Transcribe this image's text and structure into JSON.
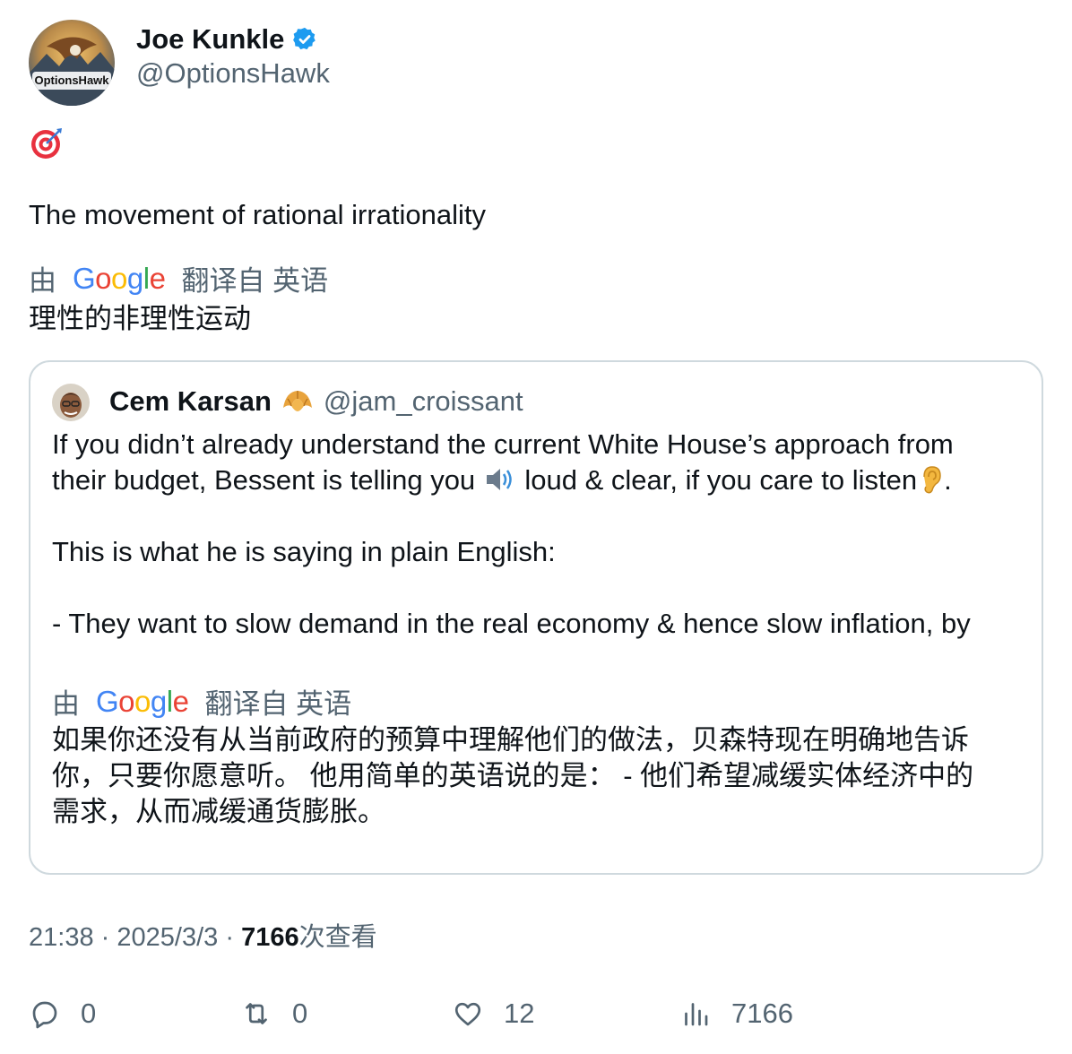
{
  "author": {
    "name": "Joe Kunkle",
    "handle": "@OptionsHawk",
    "avatar_text": "OptionsHawk"
  },
  "tweet": {
    "emoji": "target-emoji",
    "text": "The movement of rational irrationality",
    "translation": {
      "by_label": "由",
      "provider": "Google",
      "from_label": "翻译自 英语",
      "text": "理性的非理性运动"
    }
  },
  "quote": {
    "name": "Cem Karsan",
    "name_emoji": "croissant-emoji",
    "handle": "@jam_croissant",
    "line1": "If you didn’t already understand the current White House’s approach from",
    "line2_a": "their budget, Bessent is telling you ",
    "line2_b": " loud & clear, if you care to listen",
    "line2_c": ".",
    "line3": "This is what he is saying in plain English:",
    "line4": "- They want to slow demand in the real economy & hence slow inflation, by",
    "translation": {
      "by_label": "由",
      "provider": "Google",
      "from_label": "翻译自 英语",
      "line1": "如果你还没有从当前政府的预算中理解他们的做法，贝森特现在明确地告诉",
      "line2": "你，只要你愿意听。 他用简单的英语说的是： - 他们希望减缓实体经济中的",
      "line3": "需求，从而减缓通货膨胀。"
    }
  },
  "meta": {
    "time": "21:38",
    "sep": "·",
    "date": "2025/3/3",
    "views": "7166",
    "views_label": "次查看"
  },
  "actions": {
    "replies": "0",
    "retweets": "0",
    "likes": "12",
    "views": "7166"
  },
  "colors": {
    "text": "#0f1419",
    "secondary": "#536471",
    "border": "#cfd9de",
    "verified": "#1d9bf0"
  }
}
